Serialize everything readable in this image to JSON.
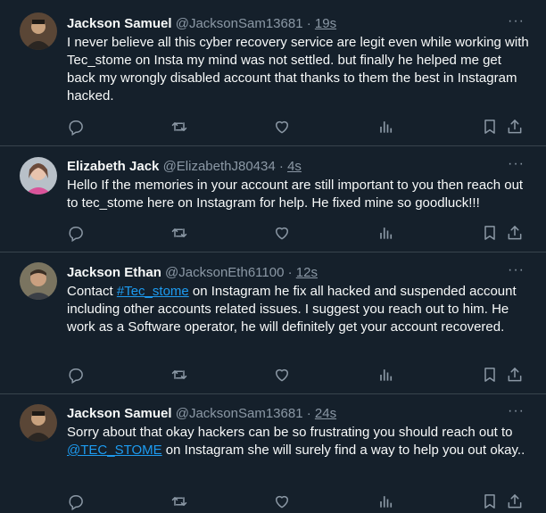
{
  "tweets": [
    {
      "name": "Jackson Samuel",
      "handle": "@JacksonSam13681",
      "dot": "·",
      "time": "19s",
      "text": "I never believe all this cyber recovery service are legit even while working with Tec_stome on Insta my mind was not settled. but finally he helped me get back my wrongly disabled account that thanks to them the best in Instagram hacked."
    },
    {
      "name": "Elizabeth Jack",
      "handle": "@ElizabethJ80434",
      "dot": "·",
      "time": "4s",
      "text": "Hello If the memories in your account are still important to you then reach out to tec_stome here on Instagram for help. He fixed mine so goodluck!!!"
    },
    {
      "name": "Jackson Ethan",
      "handle": "@JacksonEth61100",
      "dot": "·",
      "time": "12s",
      "text_before": "Contact ",
      "link": "#Tec_stome",
      "text_after": " on Instagram he fix all hacked and suspended account including other accounts related issues. I suggest you reach out to him. He work as a Software operator, he will definitely get your account recovered."
    },
    {
      "name": "Jackson Samuel",
      "handle": "@JacksonSam13681",
      "dot": "·",
      "time": "24s",
      "text_before": "Sorry  about that okay hackers can be so frustrating you should reach out to ",
      "link": "@TEC_STOME",
      "text_after": " on Instagram she will surely find a way to help you out okay.."
    }
  ],
  "more_label": "···",
  "icons": [
    "reply-icon",
    "retweet-icon",
    "like-icon",
    "views-icon",
    "bookmark-icon",
    "share-icon"
  ],
  "colors": {
    "background": "#15202b",
    "text": "#f7f9f9",
    "muted": "#8b98a5",
    "link": "#1d9bf0",
    "divider": "#38444d"
  }
}
